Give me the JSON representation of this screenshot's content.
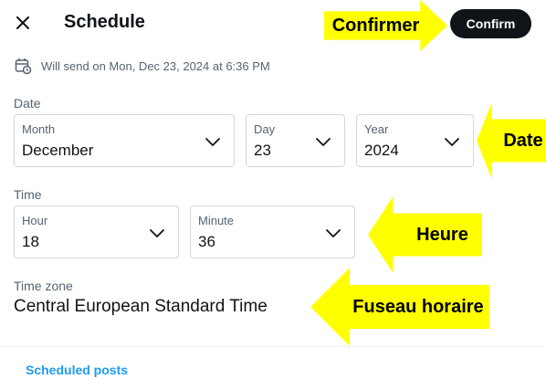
{
  "header": {
    "title": "Schedule",
    "confirm_label": "Confirm"
  },
  "send_info": "Will send on Mon, Dec 23, 2024 at 6:36 PM",
  "date_section": {
    "label": "Date",
    "month": {
      "label": "Month",
      "value": "December"
    },
    "day": {
      "label": "Day",
      "value": "23"
    },
    "year": {
      "label": "Year",
      "value": "2024"
    }
  },
  "time_section": {
    "label": "Time",
    "hour": {
      "label": "Hour",
      "value": "18"
    },
    "minute": {
      "label": "Minute",
      "value": "36"
    }
  },
  "timezone": {
    "label": "Time zone",
    "value": "Central European Standard Time"
  },
  "footer": {
    "scheduled_posts_label": "Scheduled posts"
  },
  "annotations": {
    "confirm": "Confirmer",
    "date": "Date",
    "time": "Heure",
    "timezone": "Fuseau horaire"
  },
  "colors": {
    "annotation": "#ffff00",
    "confirm_bg": "#0f1419",
    "link": "#1d9bf0"
  },
  "icons": {
    "close": "close-icon",
    "calendar_clock": "calendar-clock-icon",
    "chevron": "chevron-down-icon"
  }
}
